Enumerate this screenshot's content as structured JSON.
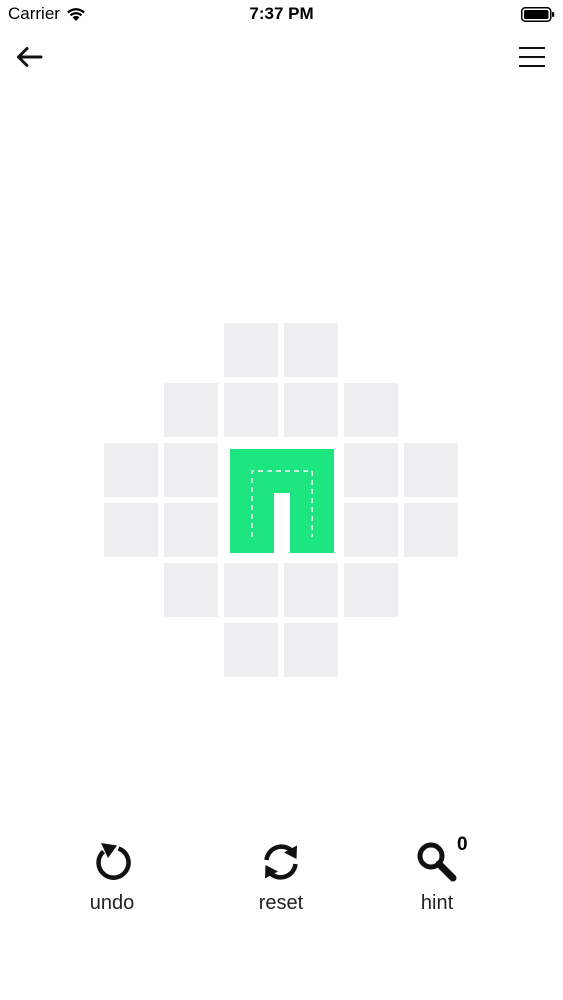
{
  "status_bar": {
    "carrier": "Carrier",
    "time": "7:37 PM",
    "wifi_icon": "wifi-icon",
    "battery_icon": "battery-full-icon"
  },
  "nav": {
    "back_icon": "back-arrow-icon",
    "menu_icon": "hamburger-menu-icon"
  },
  "board": {
    "rows": [
      [
        0,
        0,
        1,
        1,
        0,
        0
      ],
      [
        0,
        1,
        1,
        1,
        1,
        0
      ],
      [
        1,
        1,
        1,
        1,
        1,
        1
      ],
      [
        1,
        1,
        1,
        1,
        1,
        1
      ],
      [
        0,
        1,
        1,
        1,
        1,
        0
      ],
      [
        0,
        0,
        1,
        1,
        0,
        0
      ]
    ],
    "piece": {
      "shape": "n-shape",
      "color": "#1de57f",
      "covers_rows": [
        2,
        3
      ],
      "covers_cols": [
        2,
        3
      ]
    },
    "empty_cell_color": "#eeedf0"
  },
  "controls": {
    "undo": {
      "label": "undo",
      "icon": "undo-icon"
    },
    "reset": {
      "label": "reset",
      "icon": "reset-icon"
    },
    "hint": {
      "label": "hint",
      "icon": "magnifier-icon",
      "count": "0"
    }
  }
}
